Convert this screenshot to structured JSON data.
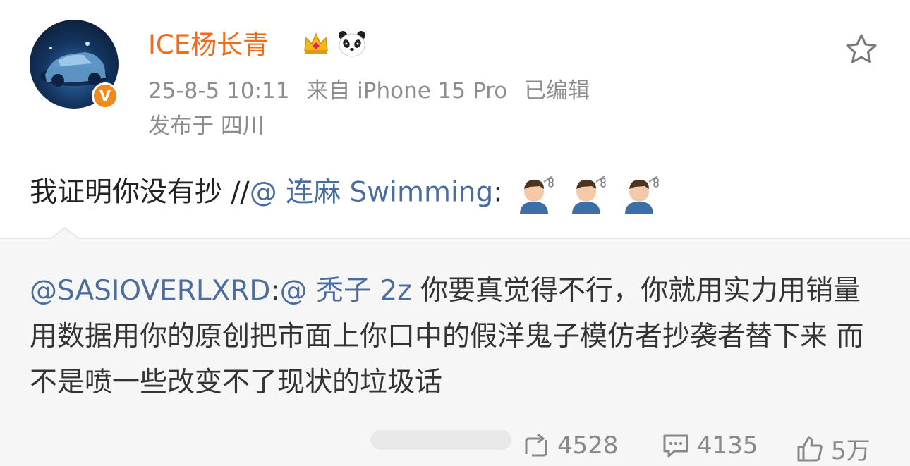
{
  "post": {
    "username": "ICE杨长青",
    "verified_badge": "V",
    "timestamp": "25-8-5 10:11",
    "source": "来自 iPhone 15 Pro",
    "edited": "已编辑",
    "location": "发布于 四川",
    "text_main": "我证明你没有抄 //",
    "text_mention": "@ 连麻 Swimming",
    "text_colon": ":"
  },
  "repost": {
    "mention1": "@SASIOVERLXRD",
    "colon": ":",
    "mention2": "@ 秃子 2z",
    "body": " 你要真觉得不行，你就用实力用销量用数据用你的原创把市面上你口中的假洋鬼子模仿者抄袭者替下来  而不是喷一些改变不了现状的垃圾话"
  },
  "actions": {
    "repost_count": "4528",
    "comment_count": "4135",
    "like_count": "5万"
  },
  "colors": {
    "username": "#f06b1a",
    "mention": "#4c6c9c",
    "meta": "#8d8d8d",
    "repost_bg": "#f6f6f6",
    "badge": "#f08a1c"
  },
  "icons": [
    "crown-emoji-icon",
    "panda-emoji-icon",
    "star-icon",
    "haircut-emoji-icon",
    "repost-icon",
    "comment-icon",
    "like-icon"
  ]
}
